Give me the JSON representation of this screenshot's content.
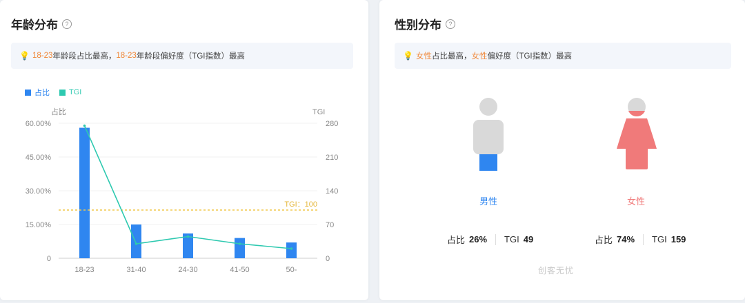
{
  "age_card": {
    "title": "年龄分布",
    "help_icon": "help-icon",
    "tip": {
      "icon": "lightbulb-icon",
      "seg1": "18-23",
      "seg2": "年龄段占比最高，",
      "seg3": "18-23",
      "seg4": "年龄段偏好度（TGI指数）最高"
    },
    "legend": {
      "share": "占比",
      "tgi": "TGI"
    }
  },
  "gender_card": {
    "title": "性别分布",
    "help_icon": "help-icon",
    "tip": {
      "icon": "lightbulb-icon",
      "seg1": "女性",
      "seg2": "占比最高，",
      "seg3": "女性",
      "seg4": "偏好度（TGI指数）最高"
    },
    "male": {
      "label": "男性",
      "share_label": "占比",
      "share": "26%",
      "tgi_label": "TGI",
      "tgi": "49",
      "fill_fraction": 0.26
    },
    "female": {
      "label": "女性",
      "share_label": "占比",
      "share": "74%",
      "tgi_label": "TGI",
      "tgi": "159",
      "fill_fraction": 0.74
    },
    "watermark": "创客无忧"
  },
  "colors": {
    "bar": "#2f86f0",
    "tgi_line": "#2ec9b0",
    "tgi_ref": "#f2c94c",
    "male": "#2f86f0",
    "female": "#f07a7a",
    "person_grey": "#d9d9d9",
    "highlight": "#f0883a"
  },
  "chart_data": {
    "type": "bar",
    "categories": [
      "18-23",
      "31-40",
      "24-30",
      "41-50",
      "50-"
    ],
    "series": [
      {
        "name": "占比",
        "type": "bar",
        "axis": "left",
        "values": [
          0.58,
          0.15,
          0.11,
          0.09,
          0.07
        ]
      },
      {
        "name": "TGI",
        "type": "line",
        "axis": "right",
        "values": [
          275,
          30,
          45,
          30,
          20
        ]
      }
    ],
    "ylabel": "占比",
    "y2label": "TGI",
    "ylim": [
      0,
      0.6
    ],
    "y2lim": [
      0,
      280
    ],
    "yticks": [
      "0",
      "15.00%",
      "30.00%",
      "45.00%",
      "60.00%"
    ],
    "y2ticks": [
      "0",
      "70",
      "140",
      "210",
      "280"
    ],
    "reference_line": {
      "label": "TGI：100",
      "value": 100,
      "axis": "right"
    },
    "legend_position": "top-left"
  }
}
